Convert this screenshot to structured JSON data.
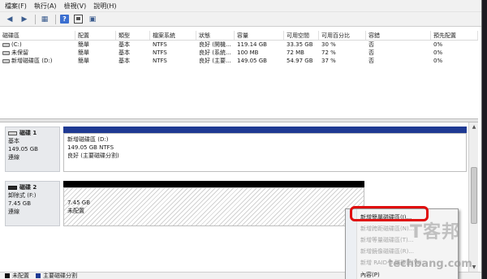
{
  "menubar": {
    "items": [
      "檔案(F)",
      "執行(A)",
      "檢視(V)",
      "說明(H)"
    ]
  },
  "toolbar": {
    "back_icon": "back-arrow-icon",
    "forward_icon": "forward-arrow-icon",
    "view_icon": "view-icon",
    "help_label": "?",
    "properties_icon": "properties-icon",
    "refresh_icon": "refresh-icon"
  },
  "volume_table": {
    "headers": [
      "磁碟區",
      "配置",
      "類型",
      "檔案系統",
      "狀態",
      "容量",
      "可用空間",
      "可用百分比",
      "容錯",
      "預先配置"
    ],
    "rows": [
      [
        "(C:)",
        "簡單",
        "基本",
        "NTFS",
        "良好 (開機...",
        "119.14 GB",
        "33.35 GB",
        "30 %",
        "否",
        "0%"
      ],
      [
        "未保留",
        "簡單",
        "基本",
        "NTFS",
        "良好 (系統...",
        "100 MB",
        "72 MB",
        "72 %",
        "否",
        "0%"
      ],
      [
        "新增磁碟區 (D:)",
        "簡單",
        "基本",
        "NTFS",
        "良好 (主要...",
        "149.05 GB",
        "54.97 GB",
        "37 %",
        "否",
        "0%"
      ]
    ]
  },
  "disks": [
    {
      "name": "磁碟 1",
      "type": "基本",
      "size": "149.05 GB",
      "status": "連線",
      "partition": {
        "title": "新增磁碟區 (D:)",
        "detail": "149.05 GB NTFS",
        "status": "良好 (主要磁碟分割)"
      }
    },
    {
      "name": "磁碟 2",
      "type": "卸除式 (F:)",
      "size": "7.45 GB",
      "status": "連線",
      "partition": {
        "title": "",
        "detail": "7.45 GB",
        "status": "未配置"
      }
    }
  ],
  "context_menu": {
    "items": [
      {
        "label": "新增簡單磁碟區(I)...",
        "enabled": true
      },
      {
        "label": "新增跨距磁碟區(N)...",
        "enabled": false
      },
      {
        "label": "新增等量磁碟區(T)...",
        "enabled": false
      },
      {
        "label": "新增鏡像磁碟區(R)...",
        "enabled": false
      },
      {
        "label": "新增 RAID-5 磁碟區(W)...",
        "enabled": false
      },
      {
        "label": "內容(P)",
        "enabled": true
      }
    ]
  },
  "legend": {
    "items": [
      {
        "label": "未配置",
        "color": "#111111"
      },
      {
        "label": "主要磁碟分割",
        "color": "#1f3a93"
      }
    ]
  },
  "watermark": {
    "brand": "T客邦",
    "url": "techbang.com"
  },
  "colors": {
    "partition_bar_blue": "#1f3a93",
    "unallocated_black": "#000000",
    "highlight_red": "#e00d0d"
  }
}
